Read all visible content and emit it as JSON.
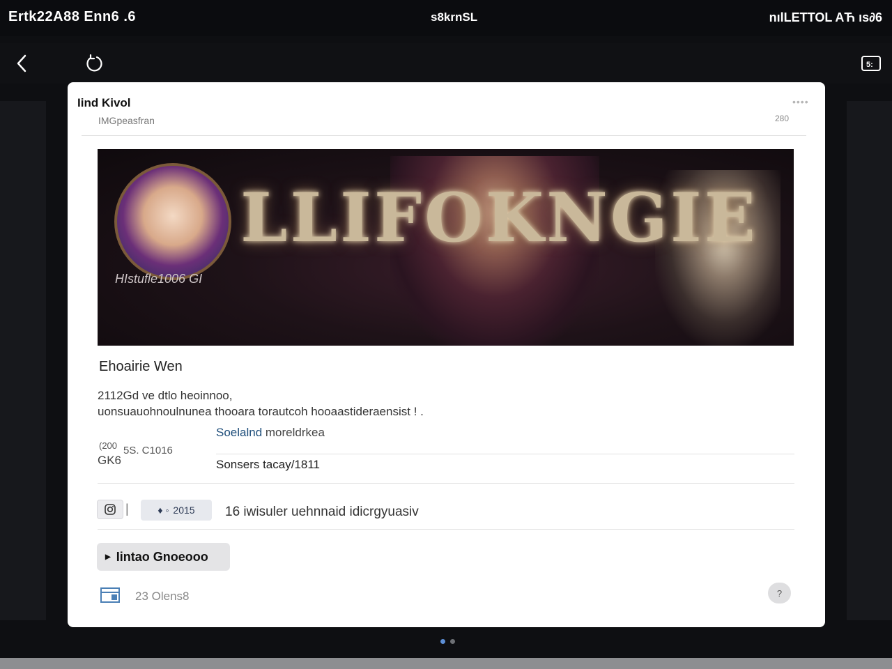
{
  "status_bar": {
    "left": "Ertk22A88  Enn6  .6",
    "center": "s8krnSL",
    "right": "nılLETTOL AЋ ıs∂6"
  },
  "card": {
    "title": "Iind Kivol",
    "subtitle": "IMGpeasfran",
    "more": "••••",
    "count": "280",
    "hero_caption": "HIstufle1006 GI",
    "hero_neon_text": "LLIFOKNGIE",
    "heading": "Ehoairie Wen",
    "desc_line_1": "2112Gd ve dtlo heoinnoo,",
    "desc_line_2": "uonsuauohnoulnunea thooara torautcoh hooaastideraensist !  .",
    "meta_small": "(200",
    "meta_left_right": "5S. C1016",
    "meta_left_bottom": "GK6",
    "link_label": "Soelalnd",
    "link_rest": " moreldrkea",
    "info_line": "Sonsers tacay/1811",
    "chip_label": "2015",
    "action_text": "16 iwisuler uehnnaid idicrgyuasiv",
    "primary_button": "Iintao Gnoeooo",
    "footer_text": "23 Olens8",
    "help_label": "?"
  },
  "colors": {
    "background": "#0e0f12",
    "card": "#ffffff",
    "link": "#1d4d7a",
    "pager_active": "#5d8fd6"
  }
}
